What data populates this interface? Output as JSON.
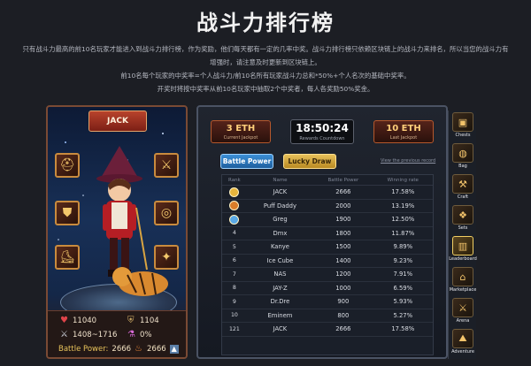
{
  "page": {
    "title": "战斗力排行榜",
    "desc_lines": [
      "只有战斗力最高的前10名玩家才能进入到战斗力排行榜，作为奖励，他们每天都有一定的几率中奖。战斗力排行榜只依赖区块链上的战斗力来排名，所以当您的战斗力有",
      "增强时，请注意及时更新到区块链上。",
      "前10名每个玩家的中奖率=个人战斗力/前10名所有玩家战斗力总和*50%+个人名次的基础中奖率。",
      "开奖时将按中奖率从前10名玩家中抽取2个中奖者，每人各奖励50%奖金。"
    ]
  },
  "hero": {
    "name": "JACK",
    "hp": "11040",
    "defense": "1104",
    "attack": "1408~1716",
    "crit": "0%",
    "battle_power_label": "Battle Power:",
    "battle_power": "2666",
    "battle_power_2": "2666",
    "slots": [
      "hat-icon",
      "sword-icon",
      "armor-icon",
      "ring-icon",
      "boots-icon",
      "amulet-icon"
    ]
  },
  "board": {
    "current_jackpot": {
      "value": "3 ETH",
      "label": "Current Jackpot"
    },
    "timer": {
      "value": "18:50:24",
      "label": "Rewards Countdown"
    },
    "last_jackpot": {
      "value": "10 ETH",
      "label": "Last Jackpot"
    },
    "tab_battle_power": "Battle Power",
    "tab_lucky_draw": "Lucky Draw",
    "prev_link": "View the previous record",
    "headers": {
      "rank": "Rank",
      "name": "Name",
      "power": "Battle Power",
      "rate": "Winning rate"
    },
    "rows": [
      {
        "rank": "1",
        "name": "JACK",
        "power": "2666",
        "rate": "17.58%",
        "medal": "#e7b53c"
      },
      {
        "rank": "2",
        "name": "Puff Daddy",
        "power": "2000",
        "rate": "13.19%",
        "medal": "#d97d2a"
      },
      {
        "rank": "3",
        "name": "Greg",
        "power": "1900",
        "rate": "12.50%",
        "medal": "#5aa9e6"
      },
      {
        "rank": "4",
        "name": "Dmx",
        "power": "1800",
        "rate": "11.87%"
      },
      {
        "rank": "5",
        "name": "Kanye",
        "power": "1500",
        "rate": "9.89%"
      },
      {
        "rank": "6",
        "name": "Ice Cube",
        "power": "1400",
        "rate": "9.23%"
      },
      {
        "rank": "7",
        "name": "NAS",
        "power": "1200",
        "rate": "7.91%"
      },
      {
        "rank": "8",
        "name": "JAY-Z",
        "power": "1000",
        "rate": "6.59%"
      },
      {
        "rank": "9",
        "name": "Dr.Dre",
        "power": "900",
        "rate": "5.93%"
      },
      {
        "rank": "10",
        "name": "Eminem",
        "power": "800",
        "rate": "5.27%"
      },
      {
        "rank": "121",
        "name": "JACK",
        "power": "2666",
        "rate": "17.58%"
      }
    ]
  },
  "menu": [
    {
      "label": "Chests",
      "icon": "chest-icon",
      "glyph": "▣"
    },
    {
      "label": "Bag",
      "icon": "bag-icon",
      "glyph": "◍"
    },
    {
      "label": "Craft",
      "icon": "craft-icon",
      "glyph": "⚒"
    },
    {
      "label": "Sets",
      "icon": "sets-icon",
      "glyph": "❖"
    },
    {
      "label": "Leaderboard",
      "icon": "leaderboard-icon",
      "glyph": "▥",
      "active": true
    },
    {
      "label": "Marketplace",
      "icon": "marketplace-icon",
      "glyph": "⌂"
    },
    {
      "label": "Arena",
      "icon": "arena-icon",
      "glyph": "⚔"
    },
    {
      "label": "Adventure",
      "icon": "adventure-icon",
      "glyph": "⛰"
    }
  ]
}
